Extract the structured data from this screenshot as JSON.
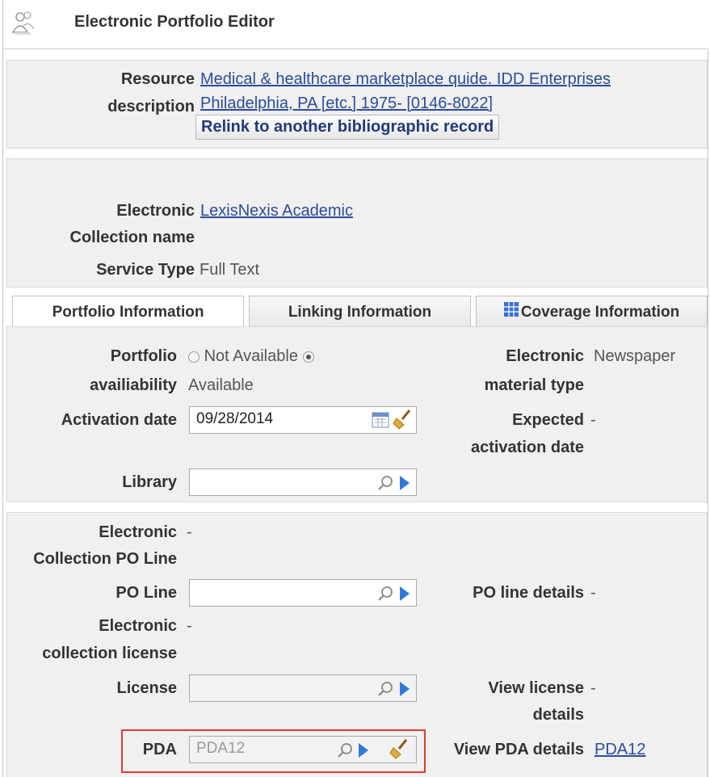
{
  "header": {
    "title": "Electronic Portfolio Editor",
    "icon": "people-icon"
  },
  "resource": {
    "label_line1": "Resource",
    "label_line2": "description",
    "link_line1": "Medical & healthcare marketplace quide. IDD Enterprises",
    "link_line2": "Philadelphia, PA [etc.] 1975- [0146-8022]",
    "relink_button": "Relink to another bibliographic record"
  },
  "collection": {
    "name_label_line1": "Electronic",
    "name_label_line2": "Collection name",
    "name_value": "LexisNexis Academic",
    "service_type_label": "Service Type",
    "service_type_value": "Full Text"
  },
  "tabs": [
    {
      "label": "Portfolio Information",
      "active": true
    },
    {
      "label": "Linking Information",
      "active": false
    },
    {
      "label": "Coverage Information",
      "active": false,
      "icon": "grid-icon"
    }
  ],
  "portfolio": {
    "availability_label_line1": "Portfolio",
    "availability_label_line2": "availiability",
    "option_not_available": "Not Available",
    "option_available": "Available",
    "selected": "Available",
    "material_type_label_line1": "Electronic",
    "material_type_label_line2": "material type",
    "material_type_value": "Newspaper",
    "activation_date_label": "Activation date",
    "activation_date_value": "09/28/2014",
    "expected_activation_label_line1": "Expected",
    "expected_activation_label_line2": "activation date",
    "expected_activation_value": "-",
    "library_label": "Library",
    "library_value": ""
  },
  "po": {
    "collection_po_label_line1": "Electronic",
    "collection_po_label_line2": "Collection PO Line",
    "collection_po_value": "-",
    "po_line_label": "PO Line",
    "po_line_value": "",
    "po_line_details_label": "PO line details",
    "po_line_details_value": "-",
    "collection_license_label_line1": "Electronic",
    "collection_license_label_line2": "collection license",
    "collection_license_value": "-",
    "license_label": "License",
    "license_value": "",
    "view_license_label_line1": "View license",
    "view_license_label_line2": "details",
    "view_license_value": "-",
    "pda_label": "PDA",
    "pda_value": "PDA12",
    "view_pda_label": "View PDA details",
    "view_pda_link": "PDA12"
  },
  "colors": {
    "link": "#2a4c9c",
    "highlight": "#e53935",
    "panel": "#f0f0f0"
  }
}
